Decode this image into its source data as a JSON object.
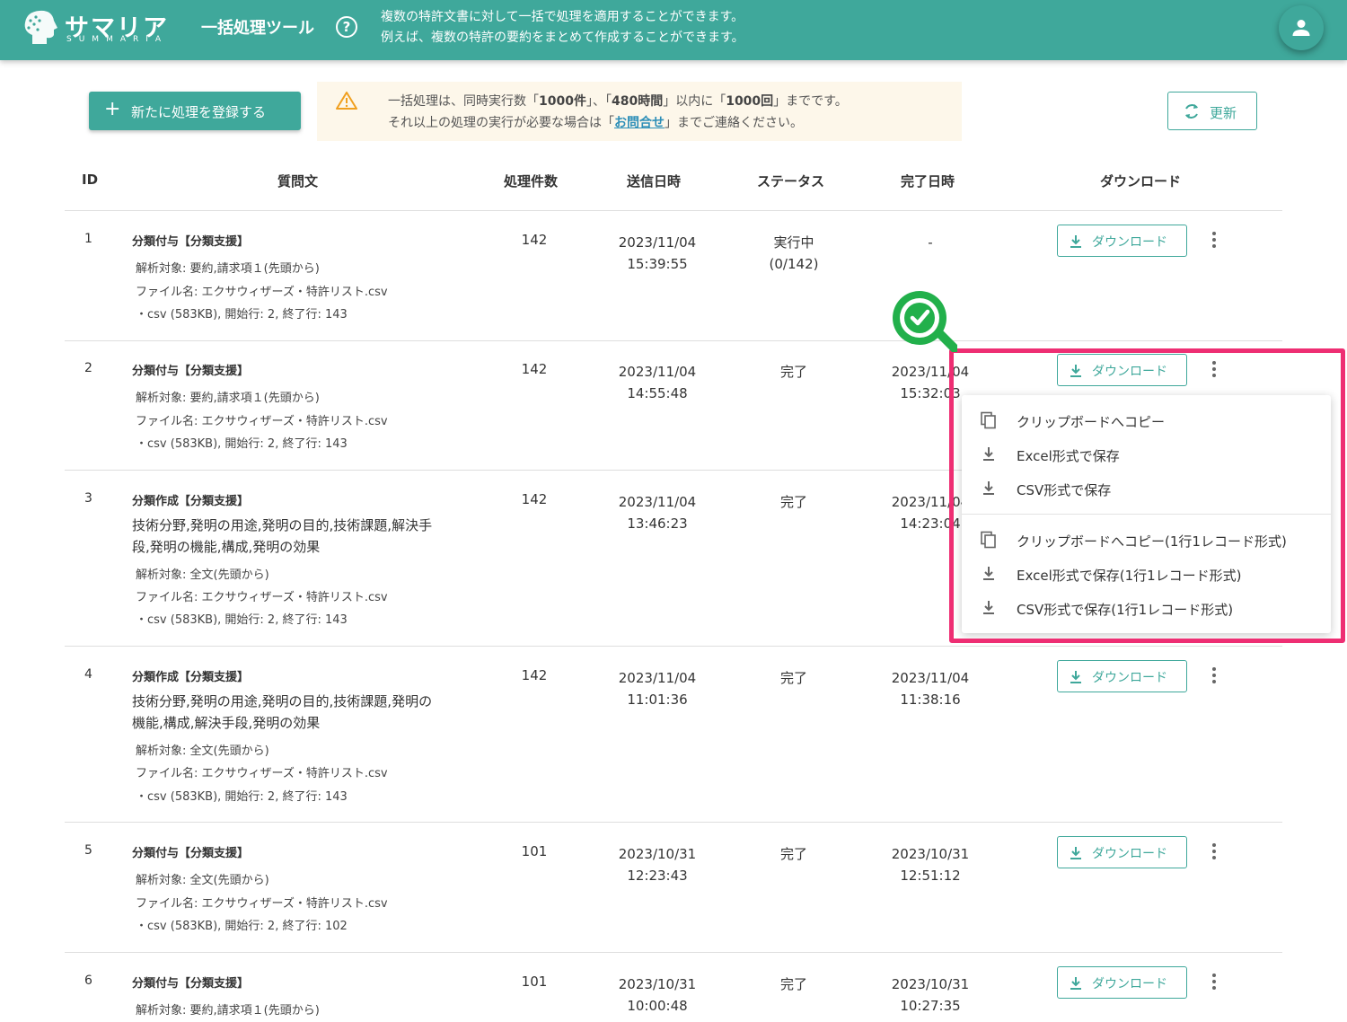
{
  "header": {
    "logo_text": "サマリア",
    "logo_sub": "SUMMARIA",
    "tool_title": "一括処理ツール",
    "help_icon": "?",
    "description_line1": "複数の特許文書に対して一括で処理を適用することができます。",
    "description_line2": "例えば、複数の特許の要約をまとめて作成することができます。",
    "avatar_icon": "person-icon"
  },
  "actions": {
    "new_button_label": "新たに処理を登録する",
    "refresh_label": "更新"
  },
  "notice": {
    "line1_prefix": "一括処理は、同時実行数「",
    "line1_b1": "1000件",
    "line1_mid1": "」、「",
    "line1_b2": "480時間",
    "line1_mid2": "」以内に「",
    "line1_b3": "1000回",
    "line1_suffix": "」までです。",
    "line2_prefix": "それ以上の処理の実行が必要な場合は「",
    "line2_link": "お問合せ",
    "line2_suffix": "」までご連絡ください。"
  },
  "table": {
    "headers": {
      "id": "ID",
      "question": "質問文",
      "count": "処理件数",
      "sent": "送信日時",
      "status": "ステータス",
      "done": "完了日時",
      "download": "ダウンロード"
    },
    "download_label": "ダウンロード",
    "rows": [
      {
        "id": "1",
        "title": "分類付与【分類支援】",
        "question_line1": "",
        "question_line2": "",
        "target": "解析対象: 要約,請求項１(先頭から)",
        "file": "ファイル名: エクサウィザーズ・特許リスト.csv",
        "file2": "・csv (583KB), 開始行: 2, 終了行: 143",
        "count": "142",
        "sent_date": "2023/11/04",
        "sent_time": "15:39:55",
        "status_line1": "実行中",
        "status_line2": "(0/142)",
        "done_date": "-",
        "done_time": ""
      },
      {
        "id": "2",
        "title": "分類付与【分類支援】",
        "question_line1": "",
        "question_line2": "",
        "target": "解析対象: 要約,請求項１(先頭から)",
        "file": "ファイル名: エクサウィザーズ・特許リスト.csv",
        "file2": "・csv (583KB), 開始行: 2, 終了行: 143",
        "count": "142",
        "sent_date": "2023/11/04",
        "sent_time": "14:55:48",
        "status_line1": "完了",
        "status_line2": "",
        "done_date": "2023/11/04",
        "done_time": "15:32:03"
      },
      {
        "id": "3",
        "title": "分類作成【分類支援】",
        "question_line1": "技術分野,発明の用途,発明の目的,技術課題,解決手",
        "question_line2": "段,発明の機能,構成,発明の効果",
        "target": "解析対象: 全文(先頭から)",
        "file": "ファイル名: エクサウィザーズ・特許リスト.csv",
        "file2": "・csv (583KB), 開始行: 2, 終了行: 143",
        "count": "142",
        "sent_date": "2023/11/04",
        "sent_time": "13:46:23",
        "status_line1": "完了",
        "status_line2": "",
        "done_date": "2023/11/04",
        "done_time": "14:23:04"
      },
      {
        "id": "4",
        "title": "分類作成【分類支援】",
        "question_line1": "技術分野,発明の用途,発明の目的,技術課題,発明の",
        "question_line2": "機能,構成,解決手段,発明の効果",
        "target": "解析対象: 全文(先頭から)",
        "file": "ファイル名: エクサウィザーズ・特許リスト.csv",
        "file2": "・csv (583KB), 開始行: 2, 終了行: 143",
        "count": "142",
        "sent_date": "2023/11/04",
        "sent_time": "11:01:36",
        "status_line1": "完了",
        "status_line2": "",
        "done_date": "2023/11/04",
        "done_time": "11:38:16"
      },
      {
        "id": "5",
        "title": "分類付与【分類支援】",
        "question_line1": "",
        "question_line2": "",
        "target": "解析対象: 全文(先頭から)",
        "file": "ファイル名: エクサウィザーズ・特許リスト.csv",
        "file2": "・csv (583KB), 開始行: 2, 終了行: 102",
        "count": "101",
        "sent_date": "2023/10/31",
        "sent_time": "12:23:43",
        "status_line1": "完了",
        "status_line2": "",
        "done_date": "2023/10/31",
        "done_time": "12:51:12"
      },
      {
        "id": "6",
        "title": "分類付与【分類支援】",
        "question_line1": "",
        "question_line2": "",
        "target": "解析対象: 要約,請求項１(先頭から)",
        "file": "",
        "file2": "",
        "count": "101",
        "sent_date": "2023/10/31",
        "sent_time": "10:00:48",
        "status_line1": "完了",
        "status_line2": "",
        "done_date": "2023/10/31",
        "done_time": "10:27:35"
      }
    ]
  },
  "menu": {
    "items": [
      {
        "label": "クリップボードへコピー",
        "icon": "copy-icon"
      },
      {
        "label": "Excel形式で保存",
        "icon": "download-icon"
      },
      {
        "label": "CSV形式で保存",
        "icon": "download-icon"
      },
      {
        "label": "クリップボードへコピー(1行1レコード形式)",
        "icon": "copy-icon"
      },
      {
        "label": "Excel形式で保存(1行1レコード形式)",
        "icon": "download-icon"
      },
      {
        "label": "CSV形式で保存(1行1レコード形式)",
        "icon": "download-icon"
      }
    ]
  },
  "colors": {
    "brand": "#3fa89b",
    "highlight": "#ee2e73",
    "notice_bg": "#fdf7ea",
    "link": "#2e8fb8",
    "check_badge": "#22b04b"
  }
}
